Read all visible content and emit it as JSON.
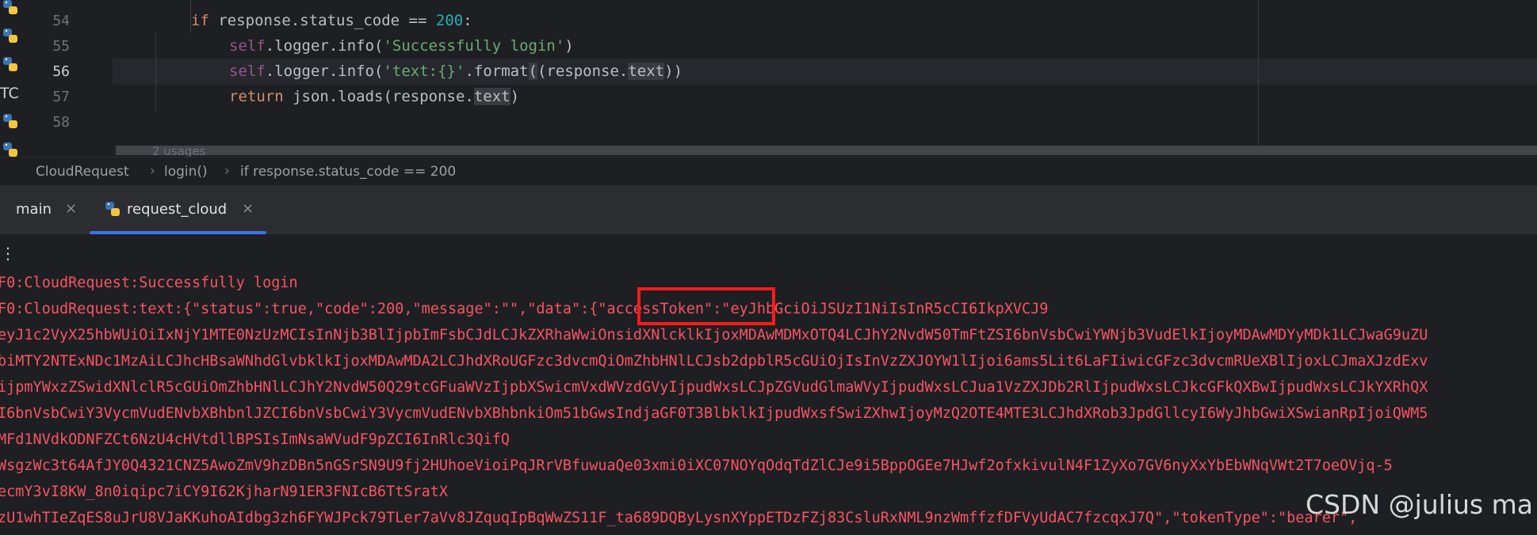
{
  "editor": {
    "lines": [
      {
        "num": "54"
      },
      {
        "num": "55"
      },
      {
        "num": "56"
      },
      {
        "num": "57"
      },
      {
        "num": "58"
      }
    ],
    "code": {
      "l54_kw": "if",
      "l54_rest": " response.status_code == ",
      "l54_num": "200",
      "l54_end": ":",
      "l55_self": "self",
      "l55_mid": ".logger.info(",
      "l55_str": "'Successfully login'",
      "l55_end": ")",
      "l56_self": "self",
      "l56_mid": ".logger.info(",
      "l56_str": "'text:{}'",
      "l56_fmt": ".format",
      "l56_a": "(response.",
      "l56_text": "text",
      "l56_end": "))",
      "l57_kw": "return",
      "l57_mid": " json.loads(response.",
      "l57_text": "text",
      "l57_end": ")"
    },
    "usages": "2 usages",
    "gutter_label": "TC"
  },
  "breadcrumbs": [
    "CloudRequest",
    "login()",
    "if response.status_code == 200"
  ],
  "tabs": [
    {
      "label": "main",
      "close": "×"
    },
    {
      "label": "request_cloud",
      "close": "×"
    }
  ],
  "console": {
    "menu_glyph": "⋮",
    "lines": [
      "F0:CloudRequest:Successfully login",
      "F0:CloudRequest:text:{\"status\":true,\"code\":200,\"message\":\"\",\"data\":{\"accessToken\":\"eyJhbGciOiJSUzI1NiIsInR5cCI6IkpXVCJ9",
      "eyJ1c2VyX25hbWUiOiIxNjY1MTE0NzUzMCIsInNjb3BlIjpbImFsbCJdLCJkZXRhaWwiOnsidXNlcklkIjoxMDAwMDMxOTQ4LCJhY2NvdW50TmFtZSI6bnVsbCwiYWNjb3VudElkIjoyMDAwMDYyMDk1LCJwaG9uZU",
      "biMTY2NTExNDc1MzAiLCJhcHBsaWNhdGlvbklkIjoxMDAwMDA2LCJhdXRoUGFzc3dvcmQiOmZhbHNlLCJsb2dpblR5cGUiOjIsInVzZXJOYW1lIjoi6ams5Lit6LaFIiwicGFzc3dvcmRUeXBlIjoxLCJmaXJzdExv",
      "ijpmYWxzZSwidXNlclR5cGUiOmZhbHNlLCJhY2NvdW50Q29tcGFuaWVzIjpbXSwicmVxdWVzdGVyIjpudWxsLCJpZGVudGlmaWVyIjpudWxsLCJua1VzZXJDb2RlIjpudWxsLCJkcGFkQXBwIjpudWxsLCJkYXRhQX",
      "I6bnVsbCwiY3VycmVudENvbXBhbnlJZCI6bnVsbCwiY3VycmVudENvbXBhbnkiOm51bGwsIndjaGF0T3BlbklkIjpudWxsfSwiZXhwIjoyMzQ2OTE4MTE3LCJhdXRob3JpdGllcyI6WyJhbGwiXSwianRpIjoiQWM5",
      "MFd1NVdkODNFZCt6NzU4cHVtdllBPSIsImNsaWVudF9pZCI6InRlc3QifQ",
      "WsgzWc3t64AfJY0Q4321CNZ5AwoZmV9hzDBn5nGSrSN9U9fj2HUhoeVioiPqJRrVBfuwuaQe03xmi0iXC07NOYqOdqTdZlCJe9i5BppOGEe7HJwf2ofxkivulN4F1ZyXo7GV6nyXxYbEbWNqVWt2T7oeOVjq-5",
      "ecmY3vI8KW_8n0iqipc7iCY9I62KjharN91ER3FNIcB6TtSratX",
      "zU1whTIeZqES8uJrU8VJaKKuhoAIdbg3zh6FYWJPck79TLer7aVv8JZquqIpBqWwZS11F_ta689DQByLysnXYppETDzFZj83CsluRxNML9nzWmffzfDFVyUdAC7fzcqxJ7Q\",\"tokenType\":\"bearer\","
    ]
  },
  "watermark": "CSDN @julius ma"
}
